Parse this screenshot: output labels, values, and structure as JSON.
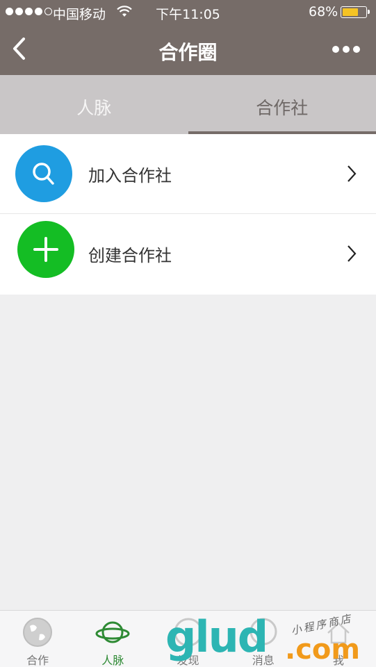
{
  "status_bar": {
    "carrier": "中国移动",
    "time": "下午11:05",
    "battery_percent": "68%",
    "battery_level": 0.68,
    "signal_bars": 4,
    "battery_color": "#f5c324"
  },
  "nav_bar": {
    "title": "合作圈",
    "back_icon": "chevron-left-icon",
    "more_icon": "more-dots-icon",
    "background": "#766c68"
  },
  "tabs": [
    {
      "label": "人脉",
      "active": false
    },
    {
      "label": "合作社",
      "active": true
    }
  ],
  "list": [
    {
      "label": "加入合作社",
      "icon": "search-icon",
      "color": "#1f9de1"
    },
    {
      "label": "创建合作社",
      "icon": "plus-icon",
      "color": "#14bd24"
    }
  ],
  "tab_bar": [
    {
      "label": "合作",
      "icon": "globe-icon",
      "active": false
    },
    {
      "label": "人脉",
      "icon": "planet-icon",
      "active": true,
      "active_color": "#2e8a34"
    },
    {
      "label": "发现",
      "icon": "compass-icon",
      "active": false
    },
    {
      "label": "消息",
      "icon": "chat-icon",
      "active": false
    },
    {
      "label": "我",
      "icon": "user-icon",
      "active": false
    }
  ],
  "watermark": {
    "logo": "glud",
    "suffix": ".com",
    "slogan": "小程序商店"
  }
}
